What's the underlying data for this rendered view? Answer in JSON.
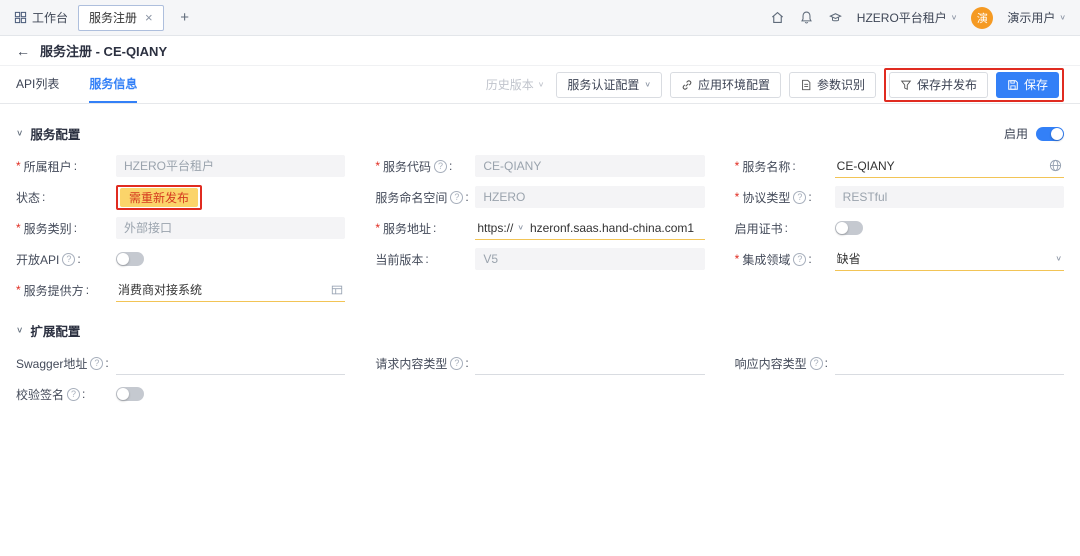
{
  "colors": {
    "primary": "#3380f7",
    "annotation_red": "#e02b20",
    "badge_bg": "#fbd46a",
    "badge_text": "#d43a1f",
    "avatar_bg": "#f59a23",
    "modified_line": "#f2c456"
  },
  "icons": {
    "close": "×",
    "plus": "+",
    "caret_down": "∨",
    "back_arrow": "←",
    "help": "?"
  },
  "topbar": {
    "workbench_label": "工作台",
    "active_tab_label": "服务注册",
    "tenant_label": "HZERO平台租户",
    "avatar_text": "演",
    "user_label": "演示用户"
  },
  "page_header": {
    "title": "服务注册 - CE-QIANY"
  },
  "tabs": {
    "api_list": "API列表",
    "service_info": "服务信息"
  },
  "toolbar": {
    "history_version": "历史版本",
    "auth_config": "服务认证配置",
    "env_config": "应用环境配置",
    "param_detect": "参数识别",
    "save_and_publish": "保存并发布",
    "save": "保存"
  },
  "service_section": {
    "title": "服务配置",
    "enable_label": "启用",
    "enable_on": true,
    "fields": {
      "tenant": {
        "label": "所属租户",
        "value": "HZERO平台租户"
      },
      "service_code": {
        "label": "服务代码",
        "value": "CE-QIANY"
      },
      "service_name": {
        "label": "服务名称",
        "value": "CE-QIANY"
      },
      "status": {
        "label": "状态",
        "badge": "需重新发布"
      },
      "namespace": {
        "label": "服务命名空间",
        "value": "HZERO"
      },
      "protocol": {
        "label": "协议类型",
        "value": "RESTful"
      },
      "category": {
        "label": "服务类别",
        "value": "外部接口"
      },
      "address": {
        "label": "服务地址",
        "protocol_prefix": "https://",
        "value": "hzeronf.saas.hand-china.com1"
      },
      "cert": {
        "label": "启用证书",
        "enabled": false
      },
      "open_api": {
        "label": "开放API",
        "enabled": false
      },
      "version": {
        "label": "当前版本",
        "value": "V5"
      },
      "domain": {
        "label": "集成领域",
        "value": "缺省"
      },
      "provider": {
        "label": "服务提供方",
        "value": "消费商对接系统"
      }
    }
  },
  "extension_section": {
    "title": "扩展配置",
    "fields": {
      "swagger": {
        "label": "Swagger地址",
        "value": ""
      },
      "request_type": {
        "label": "请求内容类型",
        "value": ""
      },
      "response_type": {
        "label": "响应内容类型",
        "value": ""
      },
      "sign": {
        "label": "校验签名",
        "enabled": false
      }
    }
  }
}
